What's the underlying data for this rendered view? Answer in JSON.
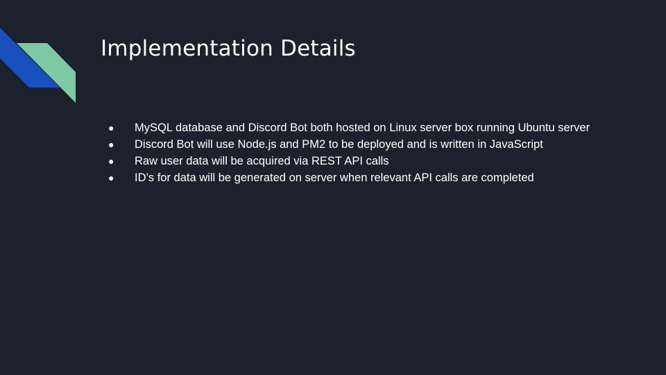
{
  "slide": {
    "title": "Implementation Details",
    "bullet_glyph": "●",
    "bullets": [
      "MySQL database and Discord Bot both hosted on Linux server box running Ubuntu server",
      "Discord Bot will use Node.js and PM2 to be deployed and is written in JavaScript",
      "Raw user data will be acquired via REST API calls",
      "ID’s for data will be generated on server when relevant API calls are completed"
    ]
  },
  "colors": {
    "background": "#1c222d",
    "accent_blue": "#1a4fbe",
    "accent_green": "#7ec8a6",
    "text": "#ffffff"
  }
}
